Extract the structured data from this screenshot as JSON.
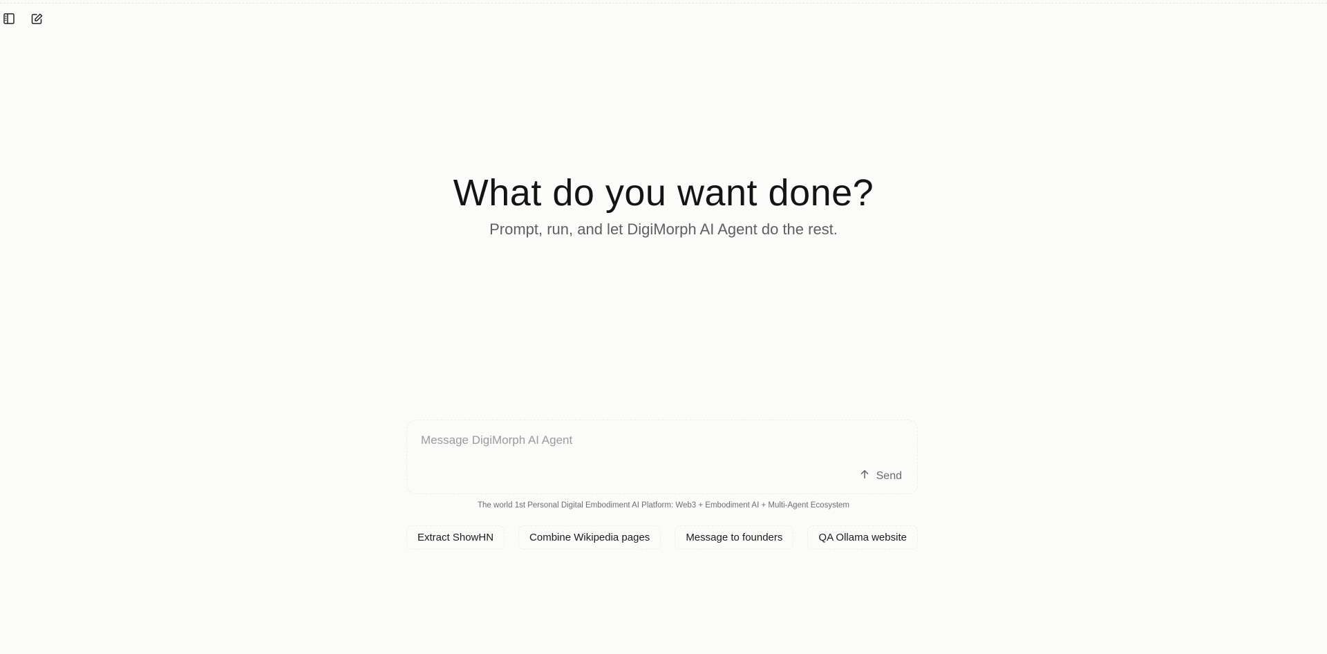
{
  "toolbar": {
    "sidebar_toggle_icon": "sidebar-icon",
    "new_chat_icon": "edit-icon"
  },
  "hero": {
    "title": "What do you want done?",
    "subtitle": "Prompt, run, and let DigiMorph AI Agent do the rest."
  },
  "composer": {
    "placeholder": "Message DigiMorph AI Agent",
    "value": "",
    "send_label": "Send",
    "send_icon": "arrow-up-icon"
  },
  "tagline": "The world 1st Personal Digital Embodiment AI Platform: Web3 + Embodiment AI + Multi-Agent Ecosystem",
  "suggestions": [
    {
      "label": "Extract ShowHN"
    },
    {
      "label": "Combine Wikipedia pages"
    },
    {
      "label": "Message to founders"
    },
    {
      "label": "QA Ollama website"
    }
  ],
  "colors": {
    "background": "#fbfbfa",
    "text": "#141414",
    "muted": "#5f5f5f"
  }
}
